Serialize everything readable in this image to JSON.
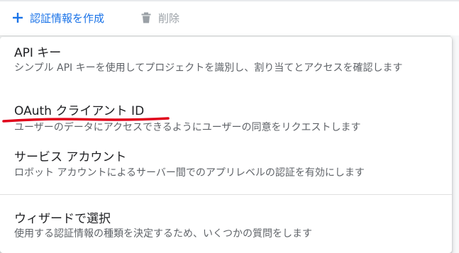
{
  "toolbar": {
    "create_label": "認証情報を作成",
    "delete_label": "削除",
    "create_icon": "plus-icon",
    "delete_icon": "trash-icon"
  },
  "menu": {
    "items": [
      {
        "title": "API キー",
        "description": "シンプル API キーを使用してプロジェクトを識別し、割り当てとアクセスを確認します"
      },
      {
        "title": "OAuth クライアント ID",
        "description": "ユーザーのデータにアクセスできるようにユーザーの同意をリクエストします"
      },
      {
        "title": "サービス アカウント",
        "description": "ロボット アカウントによるサーバー間でのアプリレベルの認証を有効にします"
      },
      {
        "title": "ウィザードで選択",
        "description": "使用する認証情報の種類を決定するため、いくつかの質問をします"
      }
    ]
  },
  "colors": {
    "accent": "#1a73e8",
    "annotation": "#e0001a",
    "disabled": "#9aa0a6"
  }
}
